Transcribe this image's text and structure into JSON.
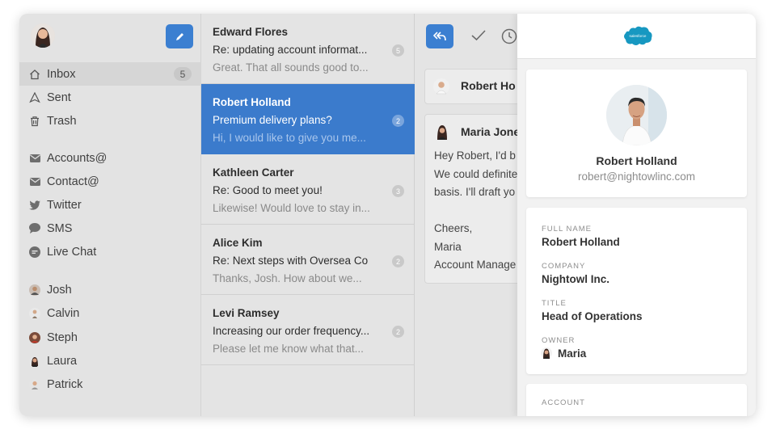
{
  "sidebar": {
    "avatar": "user-avatar",
    "compose_icon": "pencil-icon",
    "folders": [
      {
        "label": "Inbox",
        "icon": "home-icon",
        "badge": "5"
      },
      {
        "label": "Sent",
        "icon": "send-icon"
      },
      {
        "label": "Trash",
        "icon": "trash-icon"
      }
    ],
    "channels": [
      {
        "label": "Accounts@",
        "icon": "mail-icon"
      },
      {
        "label": "Contact@",
        "icon": "mail-icon"
      },
      {
        "label": "Twitter",
        "icon": "twitter-icon"
      },
      {
        "label": "SMS",
        "icon": "chat-bubble-icon"
      },
      {
        "label": "Live Chat",
        "icon": "live-chat-icon"
      }
    ],
    "people": [
      {
        "label": "Josh"
      },
      {
        "label": "Calvin"
      },
      {
        "label": "Steph"
      },
      {
        "label": "Laura"
      },
      {
        "label": "Patrick"
      }
    ]
  },
  "messages": [
    {
      "from": "Edward Flores",
      "subject": "Re: updating account informat...",
      "preview": "Great. That all sounds good to...",
      "count": "5"
    },
    {
      "from": "Robert Holland",
      "subject": "Premium delivery plans?",
      "preview": "Hi, I would like to give you me...",
      "count": "2"
    },
    {
      "from": "Kathleen Carter",
      "subject": "Re: Good to meet you!",
      "preview": "Likewise! Would love to stay in...",
      "count": "3"
    },
    {
      "from": "Alice Kim",
      "subject": "Re: Next steps with Oversea Co",
      "preview": "Thanks, Josh. How about we...",
      "count": "2"
    },
    {
      "from": "Levi Ramsey",
      "subject": "Increasing our order frequency...",
      "preview": "Please let me know what that...",
      "count": "2"
    }
  ],
  "reader": {
    "toolbar": {
      "reply_icon": "reply-all-icon",
      "done_icon": "checkmark-icon",
      "snooze_icon": "clock-icon"
    },
    "thread_1_name": "Robert Ho",
    "thread_2_name": "Maria Jone",
    "body": [
      "Hey Robert, I'd b",
      "We could definite",
      "basis. I'll draft yo",
      "",
      "Cheers,",
      "Maria",
      "Account Manage"
    ]
  },
  "crm": {
    "logo": "salesforce",
    "logo_text": "salesforce",
    "contact": {
      "name": "Robert Holland",
      "email": "robert@nightowlinc.com"
    },
    "fields": {
      "full_name_label": "FULL NAME",
      "full_name": "Robert Holland",
      "company_label": "COMPANY",
      "company": "Nightowl Inc.",
      "title_label": "TITLE",
      "title": "Head of Operations",
      "owner_label": "OWNER",
      "owner": "Maria"
    },
    "account_label": "ACCOUNT"
  },
  "colors": {
    "accent": "#3b7fd1",
    "selected_row": "#3b7bcc",
    "salesforce": "#1798c1"
  }
}
